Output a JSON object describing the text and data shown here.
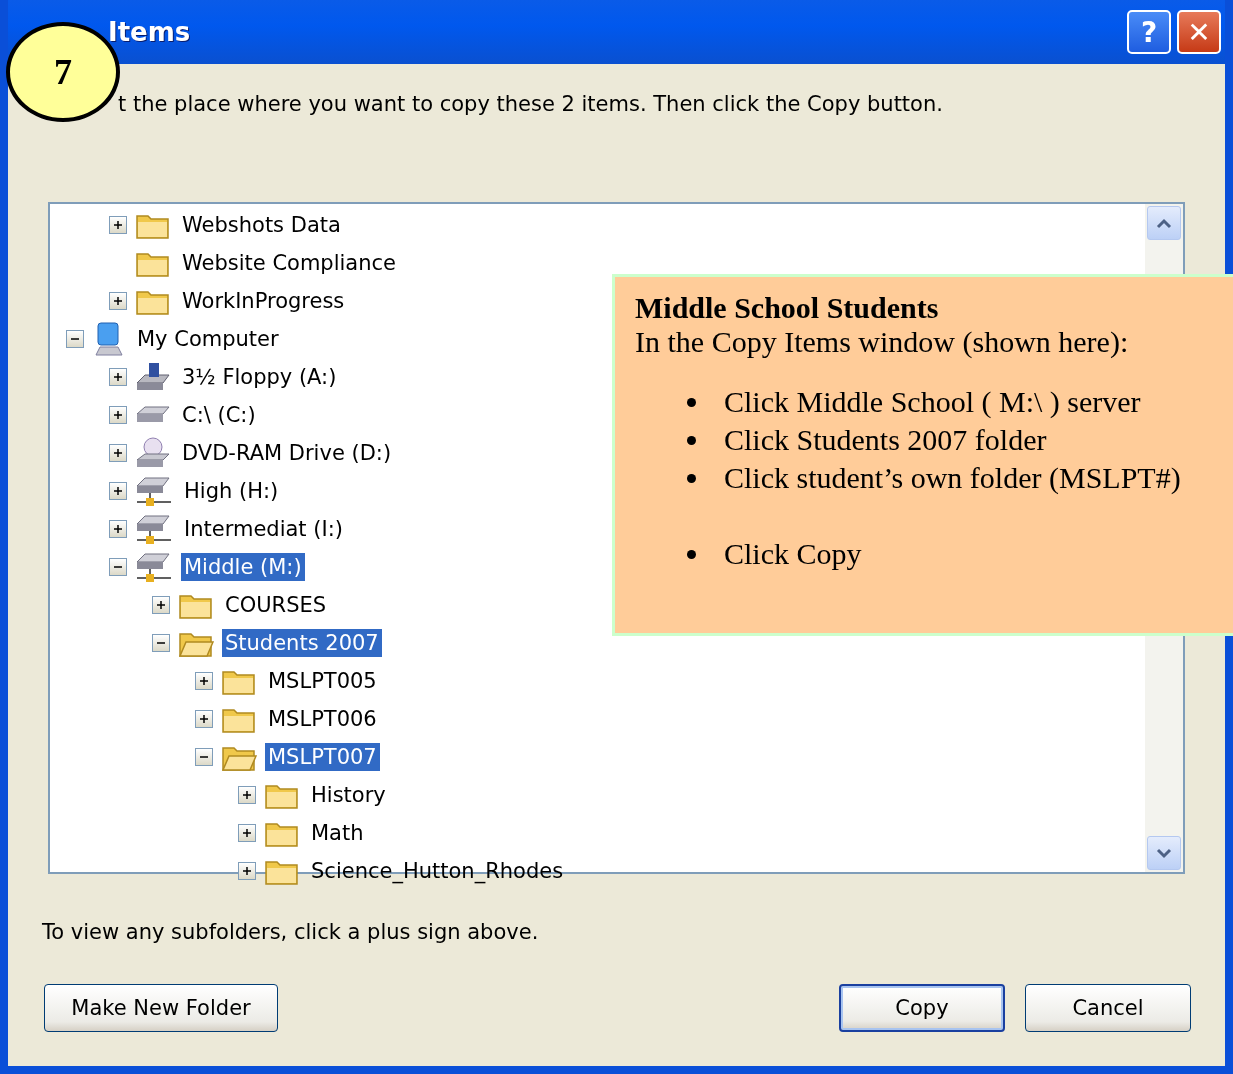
{
  "window": {
    "title": "Items",
    "buttons": [
      {
        "kind": "help",
        "label": "?"
      },
      {
        "kind": "close",
        "label": "✕"
      }
    ]
  },
  "step_badge": "7",
  "instruction": "t the place where you want to copy these 2 items. Then click the Copy button.",
  "tree": {
    "partial_items": [
      {
        "label": "Webshots Data",
        "kind": "folder",
        "expanded": false,
        "selected": false
      },
      {
        "label": "Website Compliance",
        "kind": "folder",
        "selected": false
      },
      {
        "label": "WorkInProgress",
        "kind": "folder",
        "expanded": false,
        "selected": false
      }
    ],
    "items": [
      {
        "label": "My Computer",
        "kind": "computer",
        "expanded": true,
        "selected": false,
        "children": [
          {
            "label": "3½ Floppy (A:)",
            "kind": "floppy",
            "expanded": false,
            "selected": false
          },
          {
            "label": "C:\\ (C:)",
            "kind": "disk",
            "expanded": false,
            "selected": false
          },
          {
            "label": "DVD-RAM Drive (D:)",
            "kind": "cd",
            "expanded": false,
            "selected": false
          },
          {
            "label": "High (H:)",
            "kind": "network",
            "expanded": false,
            "selected": false
          },
          {
            "label": "Intermediat (I:)",
            "kind": "network",
            "expanded": false,
            "selected": false
          },
          {
            "label": "Middle (M:)",
            "kind": "network",
            "expanded": true,
            "selected": true,
            "children": [
              {
                "label": "COURSES",
                "kind": "folder",
                "expanded": false,
                "selected": false
              },
              {
                "label": "Students 2007",
                "kind": "folder",
                "expanded": true,
                "selected": true,
                "children": [
                  {
                    "label": "MSLPT005",
                    "kind": "folder",
                    "expanded": false,
                    "selected": false
                  },
                  {
                    "label": "MSLPT006",
                    "kind": "folder",
                    "expanded": false,
                    "selected": false
                  },
                  {
                    "label": "MSLPT007",
                    "kind": "folder",
                    "expanded": true,
                    "selected": true,
                    "children": [
                      {
                        "label": "History",
                        "kind": "folder",
                        "expanded": false,
                        "selected": false
                      },
                      {
                        "label": "Math",
                        "kind": "folder",
                        "expanded": false,
                        "selected": false
                      },
                      {
                        "label": "Science_Hutton_Rhodes",
                        "kind": "folder",
                        "expanded": false,
                        "selected": false
                      }
                    ]
                  }
                ]
              }
            ]
          }
        ]
      }
    ]
  },
  "note": {
    "title": "Middle School Students",
    "subtitle": "In the Copy Items window (shown here):",
    "bullet_groups": [
      [
        "Click Middle School ( M:\\ )  server",
        "Click Students 2007 folder",
        "Click student’s own folder  (MSLPT#)"
      ],
      [
        "Click Copy"
      ]
    ]
  },
  "hint": "To view any subfolders, click a plus sign above.",
  "buttons": [
    {
      "label": "Make New Folder",
      "default": false
    },
    {
      "label": "Copy",
      "default": true
    },
    {
      "label": "Cancel",
      "default": false
    }
  ]
}
